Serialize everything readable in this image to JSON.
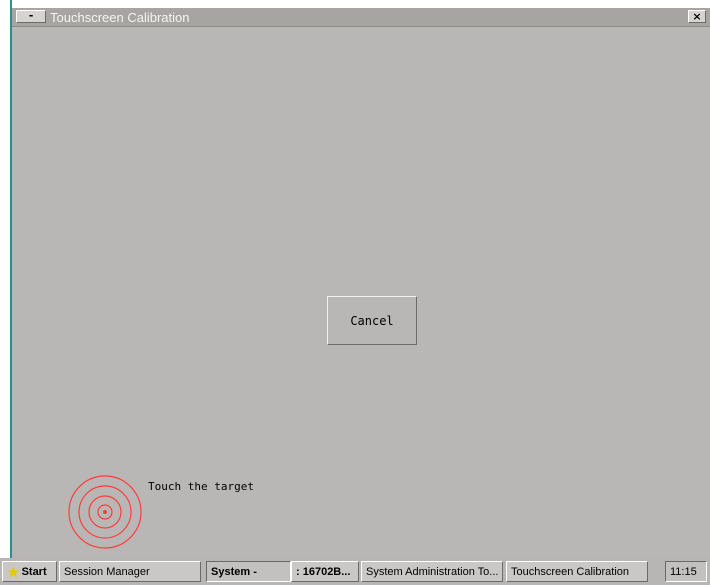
{
  "window": {
    "title": "Touchscreen Calibration",
    "sys_button": "-",
    "close_button": "×"
  },
  "content": {
    "cancel_label": "Cancel",
    "instruction": "Touch the target",
    "target_color": "#ff3b3b"
  },
  "taskbar": {
    "start_label": "Start",
    "items": [
      {
        "label": "Session Manager"
      },
      {
        "label": "System -"
      },
      {
        "label": ": 16702B..."
      },
      {
        "label": "System Administration To..."
      },
      {
        "label": "Touchscreen Calibration"
      }
    ],
    "clock": "11:15"
  },
  "colors": {
    "window_bg": "#b9b7b5",
    "titlebar_bg": "#a7a5a2",
    "accent_left_line": "#2f8f87"
  }
}
